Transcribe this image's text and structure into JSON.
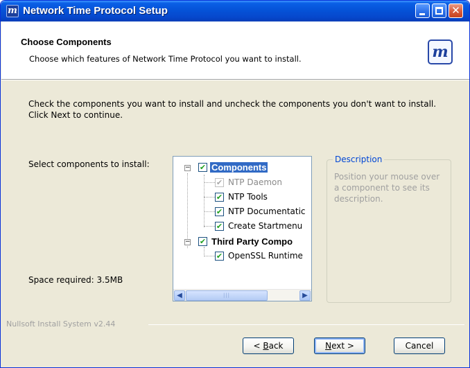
{
  "window": {
    "title": "Network Time Protocol Setup",
    "icon_letter": "m",
    "controls": {
      "minimize": "minimize",
      "maximize": "maximize",
      "close": "✕"
    }
  },
  "header": {
    "title": "Choose Components",
    "subtitle": "Choose which features of Network Time Protocol you want to install.",
    "logo_letter": "m"
  },
  "body": {
    "intro": "Check the components you want to install and uncheck the components you don't want to install. Click Next to continue.",
    "select_label": "Select components to install:",
    "space_required": "Space required: 3.5MB"
  },
  "tree": {
    "items": [
      {
        "label": "Components",
        "checked": true,
        "bold": true,
        "expanded": true,
        "selected": true
      },
      {
        "label": "NTP Daemon",
        "checked": true,
        "disabled": true
      },
      {
        "label": "NTP Tools",
        "checked": true
      },
      {
        "label": "NTP Documentatic",
        "checked": true
      },
      {
        "label": "Create Startmenu",
        "checked": true
      },
      {
        "label": "Third Party Compo",
        "checked": true,
        "bold": true,
        "expanded": true
      },
      {
        "label": "OpenSSL Runtime",
        "checked": true
      }
    ],
    "expander_glyph": "−",
    "check_glyph": "✔"
  },
  "description": {
    "title": "Description",
    "text": "Position your mouse over a component to see its description."
  },
  "branding": "Nullsoft Install System v2.44",
  "buttons": {
    "back": {
      "prefix": "< ",
      "accel": "B",
      "rest": "ack"
    },
    "next": {
      "accel": "N",
      "rest": "ext >"
    },
    "cancel": "Cancel"
  }
}
